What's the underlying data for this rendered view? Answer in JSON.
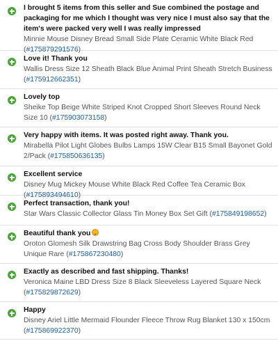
{
  "feedback": [
    {
      "comment": "I brought 5 items from this seller and Sue combined the postage and packaging for me which I thought was very nice I must also say that the item's were packed very well I was really impressed",
      "item": "Minnie Mouse Disney Bread Small Side Plate Ceramic White Black Red (",
      "item_number": "#175879291576",
      "close": ")",
      "icon": "plus-circle-icon"
    },
    {
      "comment": "Love it! Thank you",
      "item": "Wallis Dress Size 12 Sheath Black Blue Animal Print Sheath Stretch Business (",
      "item_number": "#175912662351",
      "close": ")",
      "icon": "plus-circle-icon"
    },
    {
      "comment": "Lovely top",
      "item": "Sheike Top Beige White Striped Knot Cropped Short Sleeves Round Neck Size 10 (",
      "item_number": "#175903073158",
      "close": ")",
      "icon": "plus-circle-icon"
    },
    {
      "comment": "Very happy with items. It was posted right away. Thank you.",
      "item": "Mirabella Pilot Light Globes Bulbs Lamps 15W Clear B15 Small Bayonet Gold 2/Pack (",
      "item_number": "#175850636135",
      "close": ")",
      "icon": "plus-circle-icon"
    },
    {
      "comment": "Excellent service",
      "item": "Disney Mug Mickey Mouse White Black Red Coffee Tea Ceramic Box (",
      "item_number": "#175893494610",
      "close": ")",
      "icon": "plus-circle-icon"
    },
    {
      "comment": "Perfect transaction, thank you!",
      "item": "Star Wars Classic Collector Glass Tin Money Box Set Gift (",
      "item_number": "#175849198652",
      "close": ")",
      "icon": "plus-circle-icon"
    },
    {
      "comment": "Beautiful thank you",
      "item": "Oroton Glomesh Silk Drawstring Bag Cross Body Shoulder Brass Grey Unique Rare (",
      "item_number": "#175867230480",
      "close": ")",
      "icon": "plus-circle-icon",
      "emoji": "smiling-face-icon"
    },
    {
      "comment": "Exactly as described and fast shipping. Thanks!",
      "item": "Veronica Maine LBD Dress Size 8 Black Sleeveless Layered Square Neck (",
      "item_number": "#175829872629",
      "close": ")",
      "icon": "plus-circle-icon"
    },
    {
      "comment": "Happy",
      "item": "Disney Ariel Little Mermaid Flounder Fleece Throw Rug Blanket 130 x 150cm (",
      "item_number": "#175869922370",
      "close": ")",
      "icon": "plus-circle-icon"
    }
  ],
  "colors": {
    "positive_icon": "#44a832",
    "link": "#1b5ea8",
    "divider": "#e2e2e2"
  }
}
